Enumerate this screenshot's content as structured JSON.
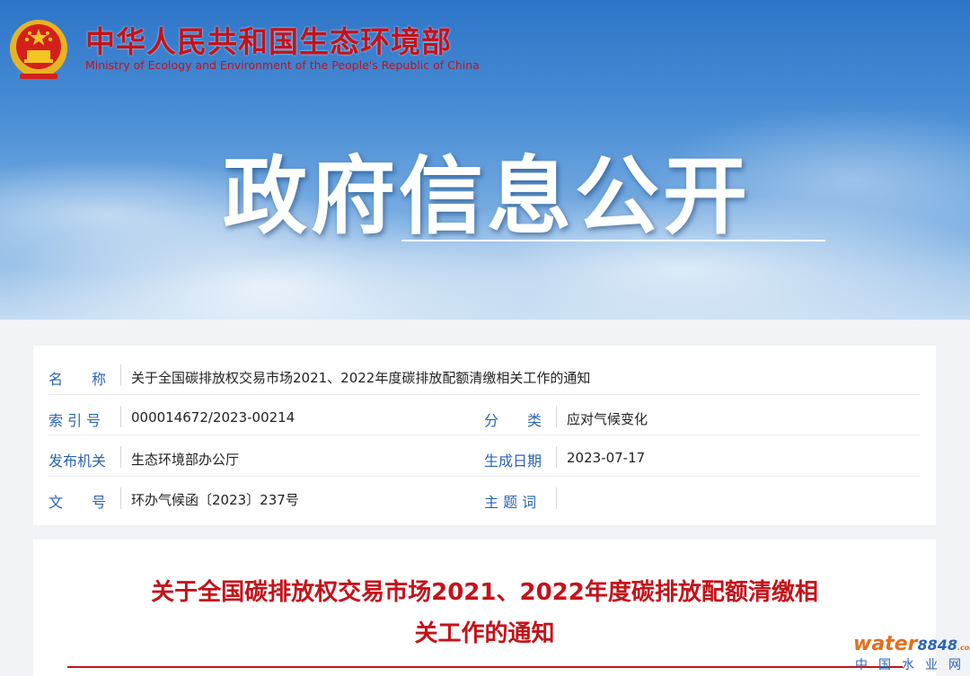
{
  "header": {
    "ministry_name_cn": "中华人民共和国生态环境部",
    "ministry_name_en": "Ministry of Ecology and Environment of the People's Republic of China",
    "section_title": "政府信息公开",
    "emblem_icon": "national-emblem-icon"
  },
  "meta": {
    "name_label": "名　　称",
    "name_value": "关于全国碳排放权交易市场2021、2022年度碳排放配额清缴相关工作的通知",
    "index_label": "索 引 号",
    "index_value": "000014672/2023-00214",
    "category_label": "分　　类",
    "category_value": "应对气候变化",
    "issuer_label": "发布机关",
    "issuer_value": "生态环境部办公厅",
    "date_label": "生成日期",
    "date_value": "2023-07-17",
    "docnum_label": "文　　号",
    "docnum_value": "环办气候函〔2023〕237号",
    "keywords_label": "主 题 词",
    "keywords_value": ""
  },
  "document": {
    "title_line1": "关于全国碳排放权交易市场2021、2022年度碳排放配额清缴相",
    "title_line2": "关工作的通知"
  },
  "watermark": {
    "brand": "water",
    "number": "8848",
    "suffix": ".com",
    "tagline": "中国水业网"
  },
  "colors": {
    "brand_red": "#c5121a",
    "label_blue": "#2a64b4",
    "sky_blue": "#4b8fd6"
  }
}
